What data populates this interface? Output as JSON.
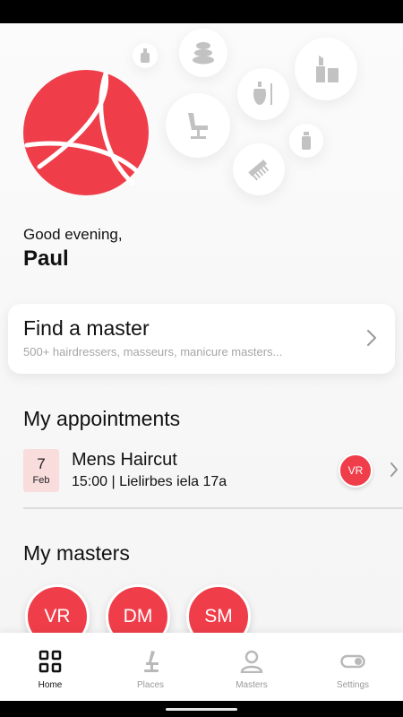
{
  "greeting": {
    "salutation": "Good evening,",
    "name": "Paul"
  },
  "decor_icons": [
    "nail-polish-icon",
    "stones-icon",
    "lipstick-icon",
    "perfume-icon",
    "hairdresser-chair-icon",
    "bottle-icon",
    "comb-icon",
    "manicure-icon"
  ],
  "find_master": {
    "title": "Find a master",
    "subtitle": "500+ hairdressers, masseurs, manicure masters..."
  },
  "appointments": {
    "section_title": "My appointments",
    "items": [
      {
        "day": "7",
        "month": "Feb",
        "title": "Mens Haircut",
        "detail": "15:00 | Lielirbes iela 17a",
        "master_initials": "VR"
      }
    ]
  },
  "masters": {
    "section_title": "My masters",
    "items": [
      {
        "initials": "VR"
      },
      {
        "initials": "DM"
      },
      {
        "initials": "SM"
      }
    ]
  },
  "nav": {
    "items": [
      {
        "label": "Home",
        "icon": "grid-icon",
        "active": true
      },
      {
        "label": "Places",
        "icon": "chair-icon",
        "active": false
      },
      {
        "label": "Masters",
        "icon": "person-icon",
        "active": false
      },
      {
        "label": "Settings",
        "icon": "toggle-icon",
        "active": false
      }
    ]
  },
  "colors": {
    "brand": "#ef3e4a",
    "date_bg": "#f9dcdc",
    "icon_grey": "#c2c2c2",
    "text": "#111111",
    "muted": "#9a9a9a"
  }
}
